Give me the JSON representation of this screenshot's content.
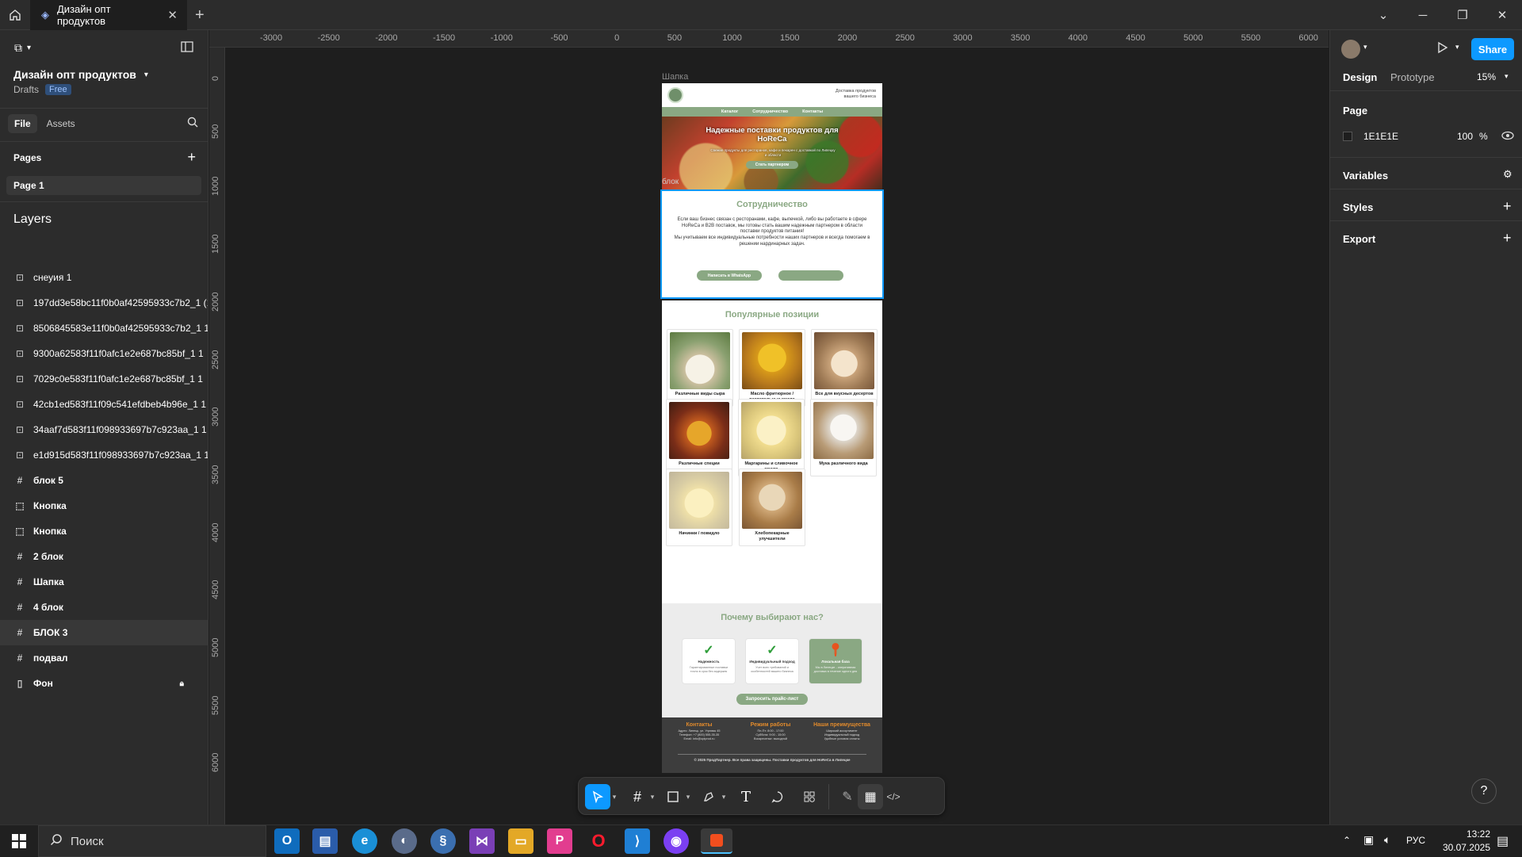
{
  "titlebar": {
    "tab_title": "Дизайн опт продуктов"
  },
  "left": {
    "project_title": "Дизайн опт продуктов",
    "drafts": "Drafts",
    "plan_badge": "Free",
    "tab_file": "File",
    "tab_assets": "Assets",
    "pages_header": "Pages",
    "pages": [
      "Page 1"
    ],
    "layers_header": "Layers",
    "layers": [
      {
        "name": "снеуия 1",
        "type": "image"
      },
      {
        "name": "197dd3e58bc11f0b0af42595933c7b2_1 (1)",
        "type": "image"
      },
      {
        "name": "8506845583e11f0b0af42595933c7b2_1 1",
        "type": "image"
      },
      {
        "name": "9300a62583f11f0afc1e2e687bc85bf_1 1",
        "type": "image"
      },
      {
        "name": "7029c0e583f11f0afc1e2e687bc85bf_1 1",
        "type": "image"
      },
      {
        "name": "42cb1ed583f11f09c541efdbeb4b96e_1 1",
        "type": "image"
      },
      {
        "name": "34aaf7d583f11f098933697b7c923aa_1 1",
        "type": "image"
      },
      {
        "name": "e1d915d583f11f098933697b7c923aa_1 1",
        "type": "image"
      },
      {
        "name": "блок 5",
        "type": "frame"
      },
      {
        "name": "Кнопка",
        "type": "dashed"
      },
      {
        "name": "Кнопка",
        "type": "dashed"
      },
      {
        "name": "2 блок",
        "type": "frame"
      },
      {
        "name": "Шапка",
        "type": "frame"
      },
      {
        "name": "4 блок",
        "type": "frame"
      },
      {
        "name": "БЛОК 3",
        "type": "frame",
        "selected": true
      },
      {
        "name": "подвал",
        "type": "frame"
      },
      {
        "name": "Фон",
        "type": "rect",
        "locked": true
      }
    ]
  },
  "rulers": {
    "h": [
      "-3000",
      "-2500",
      "-2000",
      "-1500",
      "-1000",
      "-500",
      "0",
      "500",
      "1000",
      "1500",
      "2000",
      "2500",
      "3000",
      "3500",
      "4000",
      "4500",
      "5000",
      "5500",
      "6000"
    ],
    "v": [
      "0",
      "500",
      "1000",
      "1500",
      "2000",
      "2500",
      "3000",
      "3500",
      "4000",
      "4500",
      "5000",
      "5500",
      "6000"
    ]
  },
  "right": {
    "share": "Share",
    "tab_design": "Design",
    "tab_prototype": "Prototype",
    "zoom": "15%",
    "page_header": "Page",
    "bg_color": "1E1E1E",
    "opacity": "100",
    "percent": "%",
    "variables": "Variables",
    "styles": "Styles",
    "export": "Export"
  },
  "canvas": {
    "frame_label_header": "Шапка",
    "frame_label_blok": "блок",
    "header_tagline": "Доставка продуктов вашего бизнеса",
    "nav": [
      "Каталог",
      "Сотрудничество",
      "Контакты"
    ],
    "hero_title": "Надежные поставки продуктов для HoReCa",
    "hero_sub": "Свежие продукты для ресторанов, кафе и пекарен с доставкой по Липецку и области",
    "hero_btn": "Стать партнером",
    "coop_title": "Сотрудничество",
    "coop_text1": "Если ваш бизнес связан с ресторанами, кафе, выпечкой, либо вы работаете в сфере HoReCa и B2B поставок, мы готовы стать вашим надежным партнером в области поставки продуктов питания!",
    "coop_text2": "Мы учитываем все индивидуальные потребности наших партнеров и всегда помогаем в решении нардинарных задач.",
    "coop_btn1": "Написать в WhatsApp",
    "popular_title": "Популярные позиции",
    "products": [
      "Различные виды сыра",
      "Масло фритюрное / растительные масла",
      "Все для вкусных десертов",
      "Различные специи",
      "Маргарины и сливочное масло",
      "Мука различного вида",
      "Начинки / повидло",
      "Хлебопекарные улучшители"
    ],
    "why_title": "Почему выбирают нас?",
    "why": [
      {
        "title": "Надежность",
        "text": "Гарантированные поставки точно в срок без задержек"
      },
      {
        "title": "Индивидуальный подход",
        "text": "Учет всех требований и особенностей вашего бизнеса"
      },
      {
        "title": "Локальная база",
        "text": "Мы в Липецке - оперативная доставка в течение одного дня"
      }
    ],
    "price_btn": "Запросить прайс-лист",
    "footer_cols": [
      {
        "title": "Контакты",
        "lines": [
          "Адрес: Липецк, ул. Угрюмы 45",
          "Телефон: +7 (800) 555-35-35",
          "Email: info@optprod.ru"
        ]
      },
      {
        "title": "Режим работы",
        "lines": [
          "Пн-Пт: 8:00 - 17:00",
          "Суббота: 9:00 - 15:00",
          "Воскресенье: выходной"
        ]
      },
      {
        "title": "Наши преимущества",
        "lines": [
          "Широкий ассортимент",
          "Индивидуальный подход",
          "Удобные условия оплаты"
        ]
      }
    ],
    "copyright": "© 2025 ПродПартнер. Все права защищены. Поставки продуктов для HoReCa в Липецке"
  },
  "taskbar": {
    "search": "Поиск",
    "lang": "РУС",
    "time": "13:22",
    "date": "30.07.2025"
  },
  "colors": {
    "figma_blue": "#0d99ff",
    "brand_green": "#8aa883",
    "accent_orange": "#e08a2c",
    "canvas_bg": "#1e1e1e"
  }
}
